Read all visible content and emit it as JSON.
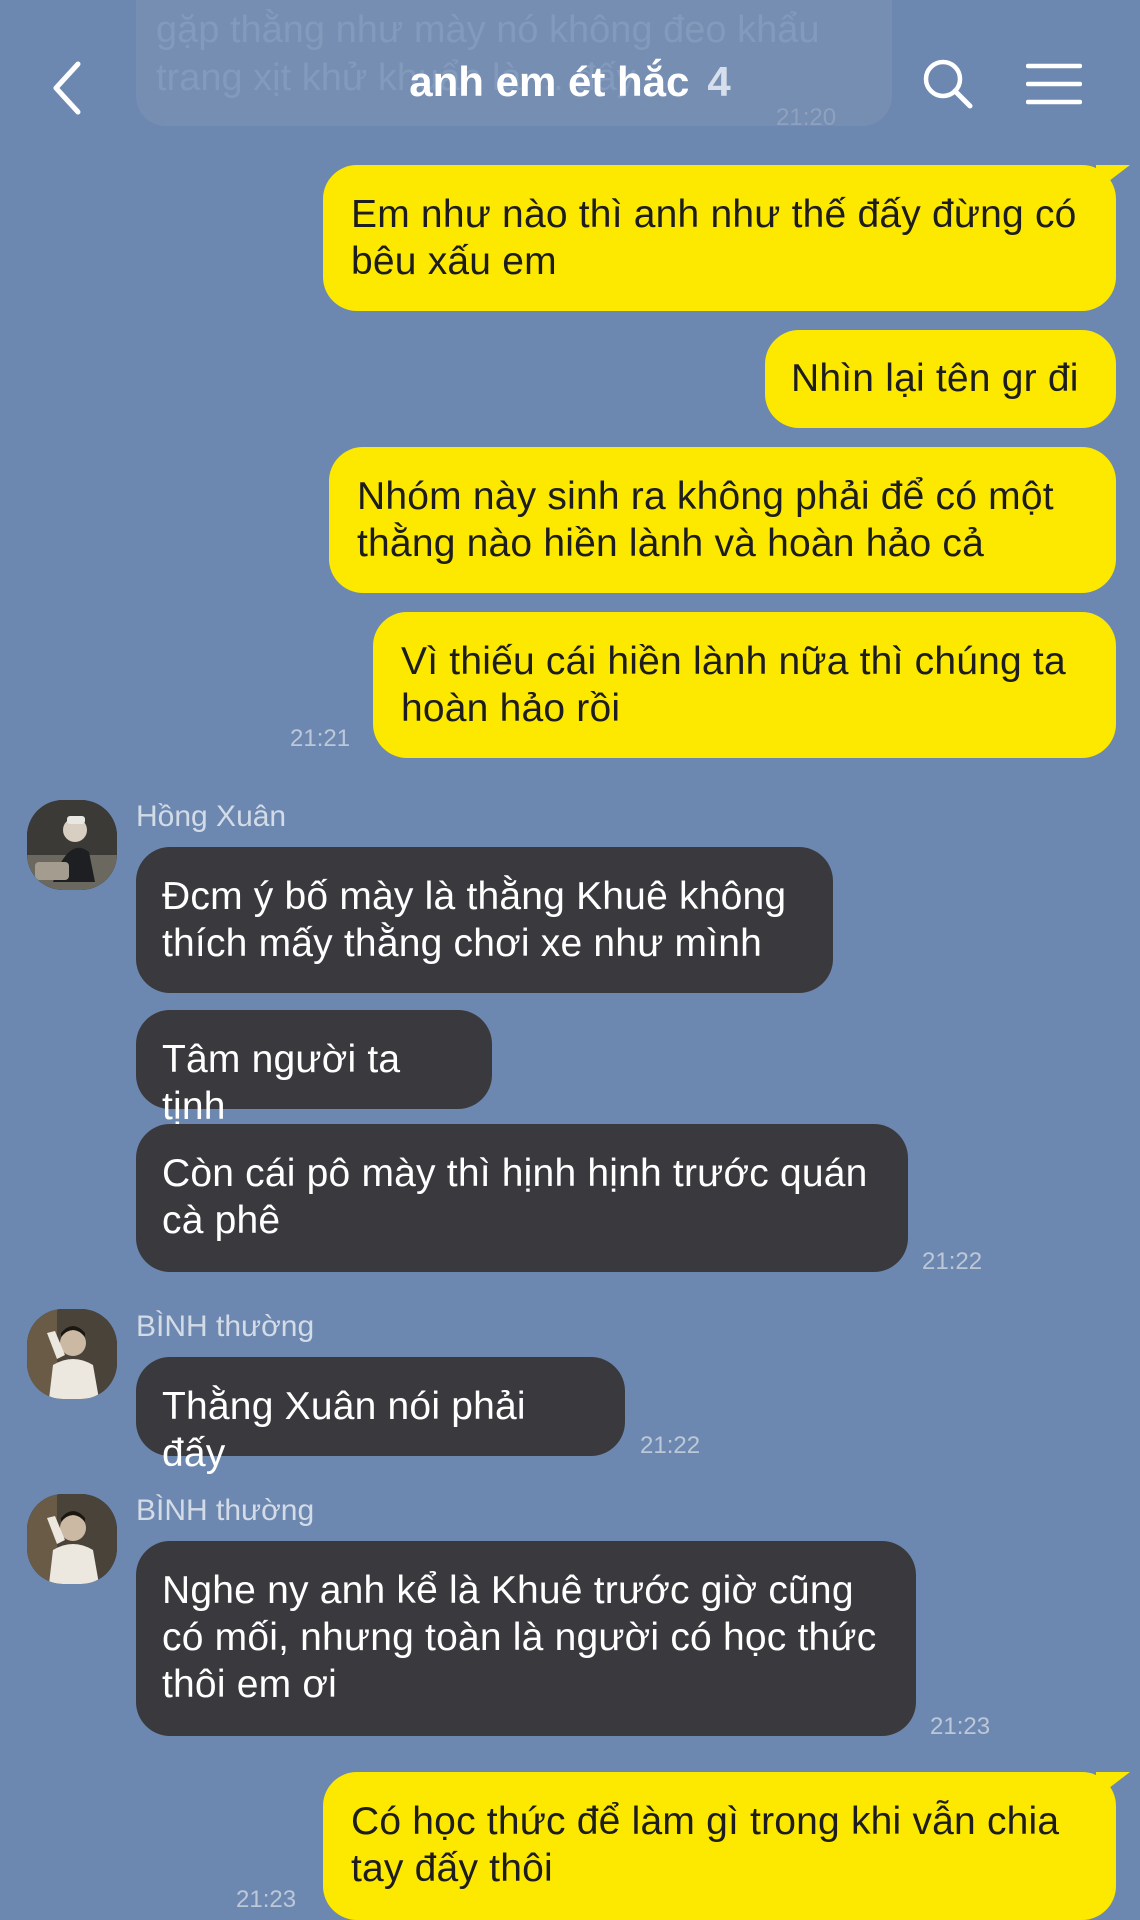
{
  "header": {
    "title": "anh em ét hắc",
    "member_count": "4"
  },
  "previous_message": {
    "text": "gặp thằng như mày nó không đeo khẩu trang xịt khử khuẩn là ... đấy",
    "time": "21:20"
  },
  "messages": [
    {
      "text": "Em như nào thì anh như thế đấy đừng có bêu xấu em"
    },
    {
      "text": "Nhìn lại tên gr đi"
    },
    {
      "text": "Nhóm này sinh ra không phải để có một thằng nào hiền lành và hoàn hảo cả"
    },
    {
      "text": "Vì thiếu cái hiền lành nữa thì chúng ta hoàn hảo rồi",
      "time": "21:21"
    },
    {
      "sender": "Hồng Xuân",
      "text": "Đcm ý bố mày là thằng Khuê không thích mấy thằng chơi xe như mình"
    },
    {
      "text": "Tâm người ta tịnh"
    },
    {
      "text": "Còn cái pô mày thì hịnh hịnh trước quán cà phê",
      "time": "21:22"
    },
    {
      "sender": "BÌNH thường",
      "text": "Thằng Xuân nói phải đấy",
      "time": "21:22"
    },
    {
      "sender": "BÌNH thường",
      "text": "Nghe ny anh kể là Khuê trước giờ cũng có mối, nhưng toàn là người có học thức thôi em ơi",
      "time": "21:23"
    },
    {
      "text": "Có học thức để làm gì trong khi vẫn chia tay đấy thôi",
      "time": "21:23"
    }
  ],
  "colors": {
    "background": "#6d88b0",
    "my_bubble": "#fde800",
    "their_bubble": "#3a3a3e"
  },
  "icons": [
    "back-icon",
    "search-icon",
    "menu-icon"
  ]
}
